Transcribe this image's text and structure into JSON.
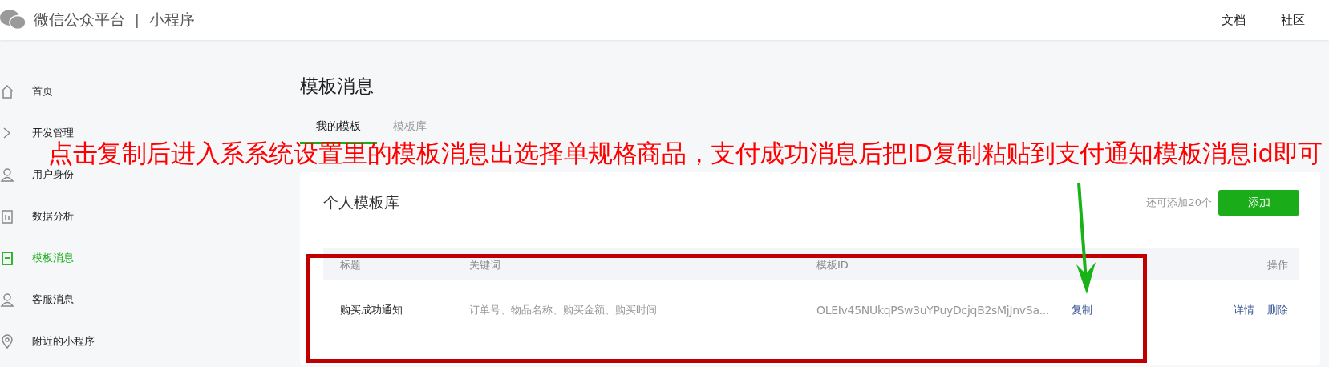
{
  "header": {
    "brand": "微信公众平台",
    "separator": "|",
    "product": "小程序",
    "links": [
      "文档",
      "社区"
    ]
  },
  "sidebar": {
    "items": [
      {
        "label": "首页",
        "selected": false
      },
      {
        "label": "开发管理",
        "selected": false
      },
      {
        "label": "用户身份",
        "selected": false
      },
      {
        "label": "数据分析",
        "selected": false
      },
      {
        "label": "模板消息",
        "selected": true
      },
      {
        "label": "客服消息",
        "selected": false
      },
      {
        "label": "附近的小程序",
        "selected": false
      }
    ]
  },
  "page": {
    "title": "模板消息",
    "tabs": [
      {
        "label": "我的模板",
        "selected": true
      },
      {
        "label": "模板库",
        "selected": false
      }
    ]
  },
  "card": {
    "title": "个人模板库",
    "quota": "还可添加20个",
    "add_button": "添加",
    "table": {
      "columns": [
        "标题",
        "关键词",
        "模板ID",
        "操作"
      ],
      "rows": [
        {
          "title": "购买成功通知",
          "keywords": "订单号、物品名称、购买金额、购买时间",
          "template_id": "OLEIv45NUkqPSw3uYPuyDcjqB2sMjJnvSa...",
          "copy": "复制",
          "actions": [
            "详情",
            "删除"
          ]
        }
      ]
    }
  },
  "annotation": {
    "text": "点击复制后进入系系统设置里的模板消息出选择单规格商品，支付成功消息后把ID复制粘贴到支付通知模板消息id即可"
  }
}
